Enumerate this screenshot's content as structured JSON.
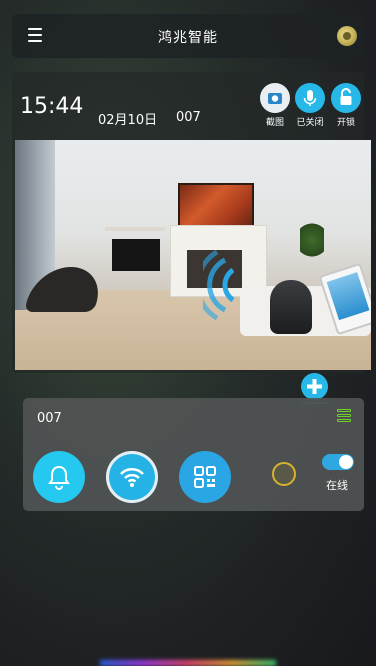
{
  "header": {
    "title": "鸿兆智能"
  },
  "panel": {
    "time": "15:44",
    "date": "02月10日",
    "device_no": "007",
    "controls": [
      {
        "label": "截图",
        "icon": "camera-icon",
        "color": "#27b8e8"
      },
      {
        "label": "已关闭",
        "icon": "microphone-icon",
        "color": "#27b8e8"
      },
      {
        "label": "开锁",
        "icon": "lock-icon",
        "color": "#27b8e8"
      }
    ]
  },
  "device_card": {
    "name": "007",
    "status_label": "在线",
    "toggle_on": true,
    "buttons": [
      {
        "icon": "bell-icon"
      },
      {
        "icon": "wifi-icon"
      },
      {
        "icon": "qr-code-icon"
      }
    ]
  },
  "colors": {
    "accent": "#27b8e8",
    "status_ring": "#d8b32c",
    "list_icon": "#6ed024"
  }
}
